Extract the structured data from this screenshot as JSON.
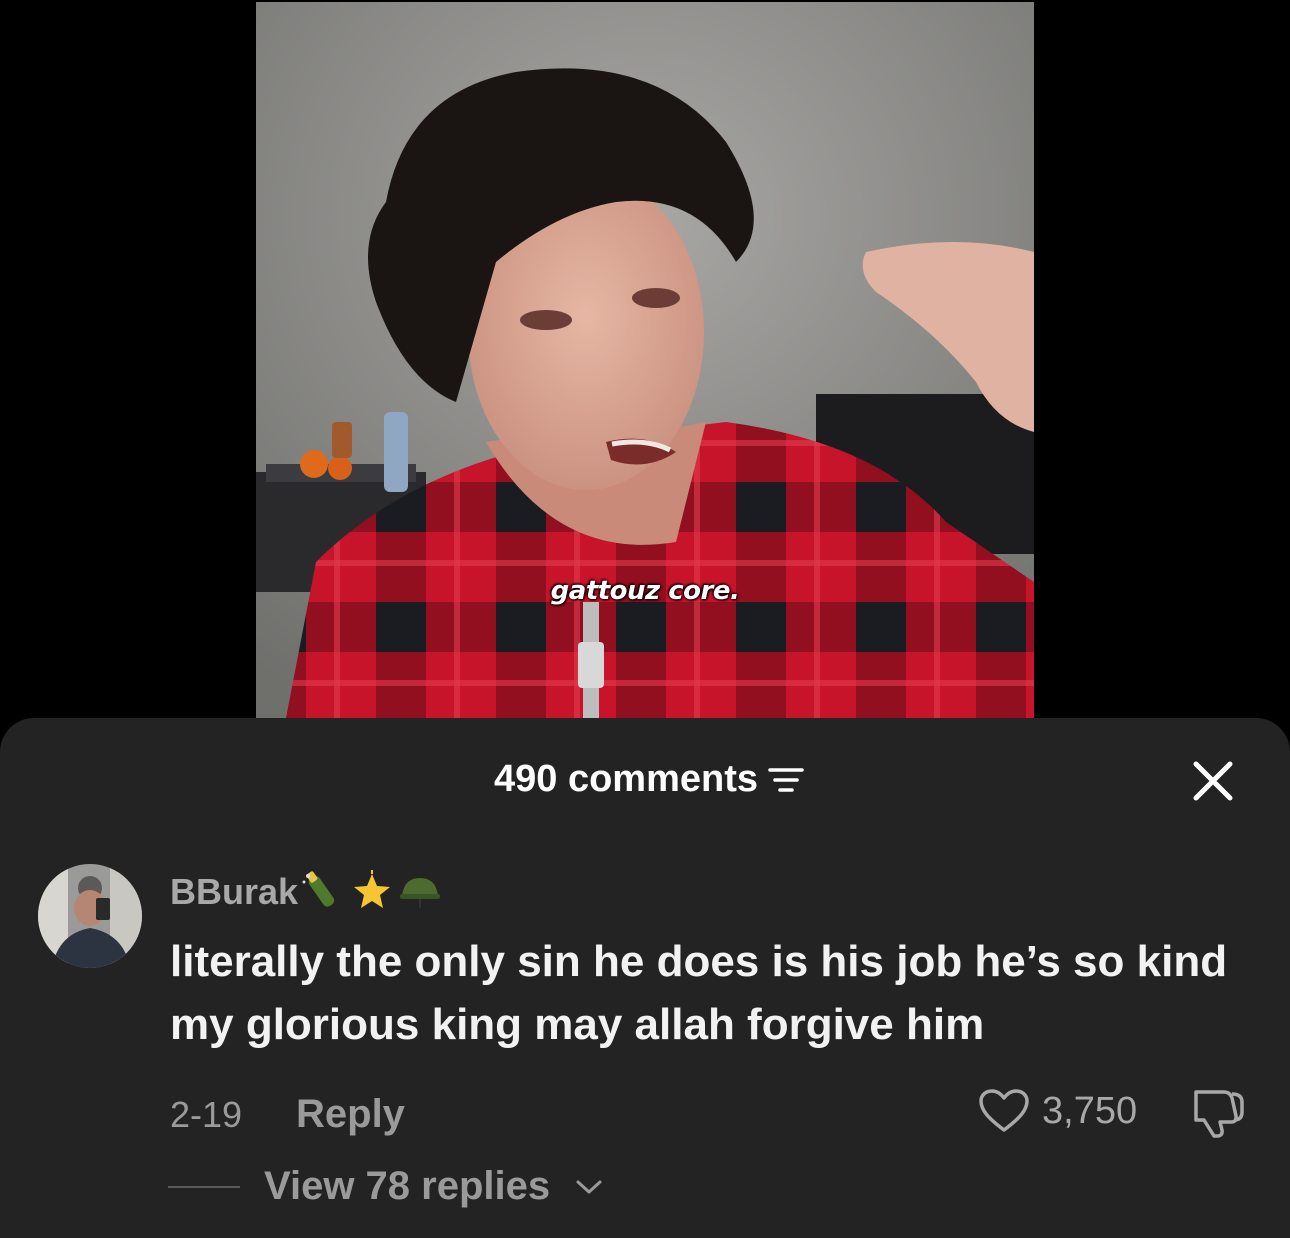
{
  "video": {
    "caption": "gattouz core."
  },
  "sheet": {
    "comments_count": "490 comments",
    "filter_icon": "filter-icon",
    "close_icon": "close-icon"
  },
  "comment": {
    "username": "BBurak",
    "badges": [
      "champagne-icon",
      "glowing-star-icon",
      "military-helmet-icon"
    ],
    "text": "literally the only sin he does is his job he’s so kind my glorious king may allah forgive him",
    "date": "2-19",
    "reply_label": "Reply",
    "like_count": "3,750",
    "view_replies_label": "View 78 replies"
  },
  "colors": {
    "sheet_background": "#232323",
    "muted_text": "#9a9a9a",
    "primary_text": "#f2f2f2"
  }
}
